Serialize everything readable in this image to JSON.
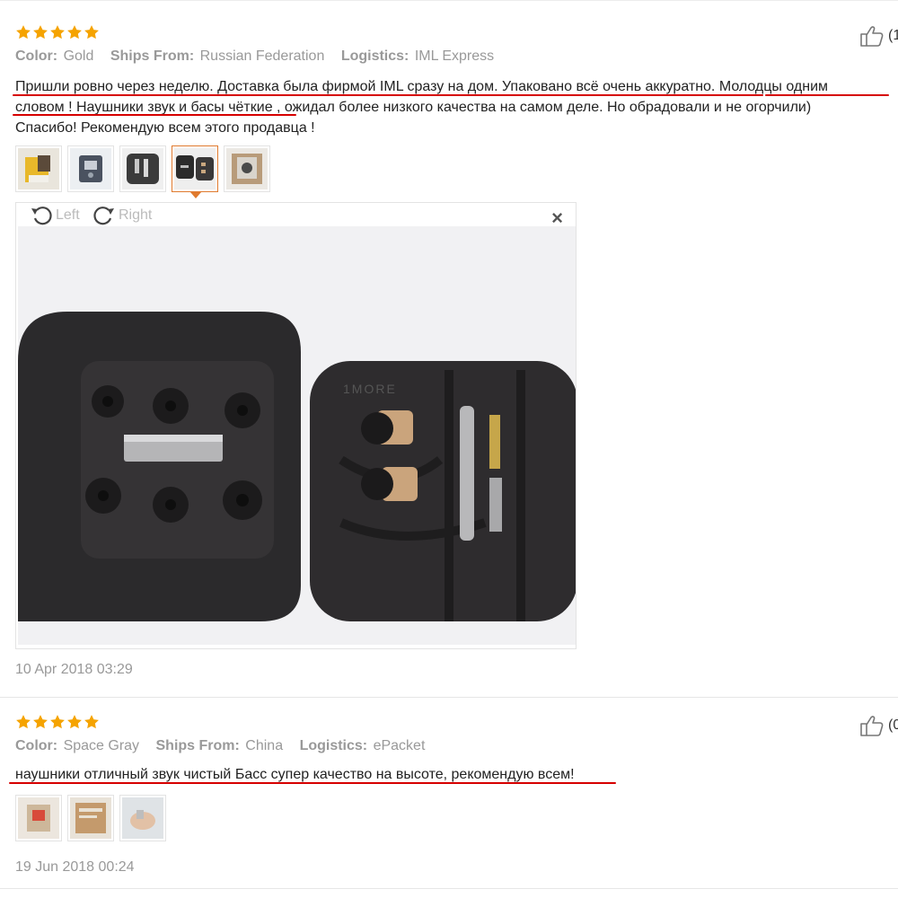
{
  "reviews": [
    {
      "rating": 5,
      "useful_count_visible": "(1",
      "color_key": "Color:",
      "color_value": "Gold",
      "ships_key": "Ships From:",
      "ships_value": "Russian Federation",
      "logistics_key": "Logistics:",
      "logistics_value": "IML Express",
      "text_line1": "Пришли ровно через неделю. Доставка была фирмой IML сразу на дом. Упаковано всё очень аккуратно. Молодцы одним",
      "text_line2": "словом ! Наушники звук и басы чёткие , ожидал более низкого качества на самом деле. Но обрадовали и не огорчили)",
      "text_line3": "Спасибо! Рекомендую всем этого продавца !",
      "viewer": {
        "rotate_left_label": "Left",
        "rotate_right_label": "Right",
        "close_symbol": "×"
      },
      "date": "10 Apr 2018 03:29"
    },
    {
      "rating": 5,
      "useful_count_visible": "(0",
      "color_key": "Color:",
      "color_value": "Space Gray",
      "ships_key": "Ships From:",
      "ships_value": "China",
      "logistics_key": "Logistics:",
      "logistics_value": "ePacket",
      "text_line1": "наушники отличный звук чистый Басс супер качество на высоте, рекомендую всем!",
      "date": "19 Jun 2018 00:24"
    }
  ],
  "colors": {
    "star": "#f5a300",
    "underline": "#d60000",
    "active_thumb": "#e07a2e"
  },
  "icons": {
    "star": "star-icon",
    "like": "thumbs-up-icon",
    "rotate_left": "rotate-left-icon",
    "rotate_right": "rotate-right-icon",
    "close": "close-icon"
  }
}
